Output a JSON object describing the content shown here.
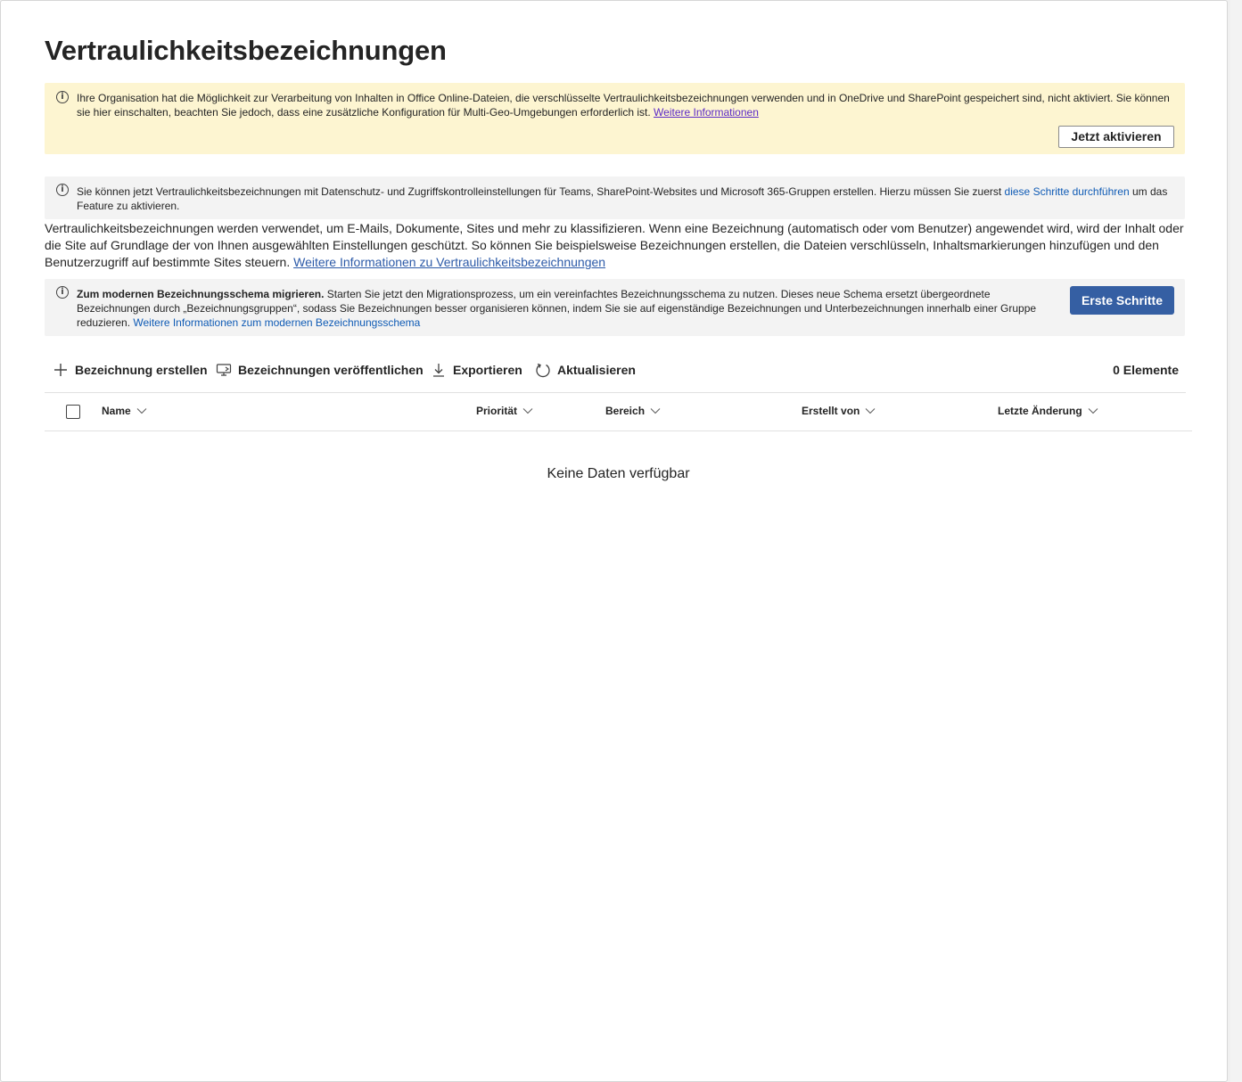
{
  "page": {
    "title": "Vertraulichkeitsbezeichnungen"
  },
  "banner_warning": {
    "text": "Ihre Organisation hat die Möglichkeit zur Verarbeitung von Inhalten in Office Online-Dateien, die verschlüsselte Vertraulichkeitsbezeichnungen verwenden und in OneDrive und SharePoint gespeichert sind, nicht aktiviert. Sie können sie hier einschalten, beachten Sie jedoch, dass eine zusätzliche Konfiguration für Multi-Geo-Umgebungen erforderlich ist.",
    "link": "Weitere Informationen",
    "button": "Jetzt aktivieren"
  },
  "banner_info": {
    "text": "Sie können jetzt Vertraulichkeitsbezeichnungen mit Datenschutz- und Zugriffskontrolleinstellungen für Teams, SharePoint-Websites und Microsoft 365-Gruppen erstellen. Hierzu müssen Sie zuerst",
    "link": "diese Schritte durchführen",
    "text_after": "um das Feature zu aktivieren."
  },
  "description": {
    "text": "Vertraulichkeitsbezeichnungen werden verwendet, um E-Mails, Dokumente, Sites und mehr zu klassifizieren. Wenn eine Bezeichnung (automatisch oder vom Benutzer) angewendet wird, wird der Inhalt oder die Site auf Grundlage der von Ihnen ausgewählten Einstellungen geschützt. So können Sie beispielsweise Bezeichnungen erstellen, die Dateien verschlüsseln, Inhaltsmarkierungen hinzufügen und den Benutzerzugriff auf bestimmte Sites steuern.",
    "link": "Weitere Informationen zu Vertraulichkeitsbezeichnungen"
  },
  "banner_migrate": {
    "bold": "Zum modernen Bezeichnungsschema migrieren.",
    "text": "Starten Sie jetzt den Migrationsprozess, um ein vereinfachtes Bezeichnungsschema zu nutzen. Dieses neue Schema ersetzt übergeordnete Bezeichnungen durch „Bezeichnungsgruppen“, sodass Sie Bezeichnungen besser organisieren können, indem Sie sie auf eigenständige Bezeichnungen und Unterbezeichnungen innerhalb einer Gruppe reduzieren.",
    "link": "Weitere Informationen zum modernen Bezeichnungsschema",
    "button": "Erste Schritte"
  },
  "toolbar": {
    "create": "Bezeichnung erstellen",
    "publish": "Bezeichnungen veröffentlichen",
    "export": "Exportieren",
    "refresh": "Aktualisieren",
    "count": "0 Elemente"
  },
  "table": {
    "columns": [
      "Name",
      "Priorität",
      "Bereich",
      "Erstellt von",
      "Letzte Änderung"
    ],
    "empty_text": "Keine Daten verfügbar"
  },
  "colors": {
    "warning_bg": "#fdf5d1",
    "info_bg": "#f3f3f3",
    "primary": "#355fa3",
    "link": "#0f5bb5"
  }
}
